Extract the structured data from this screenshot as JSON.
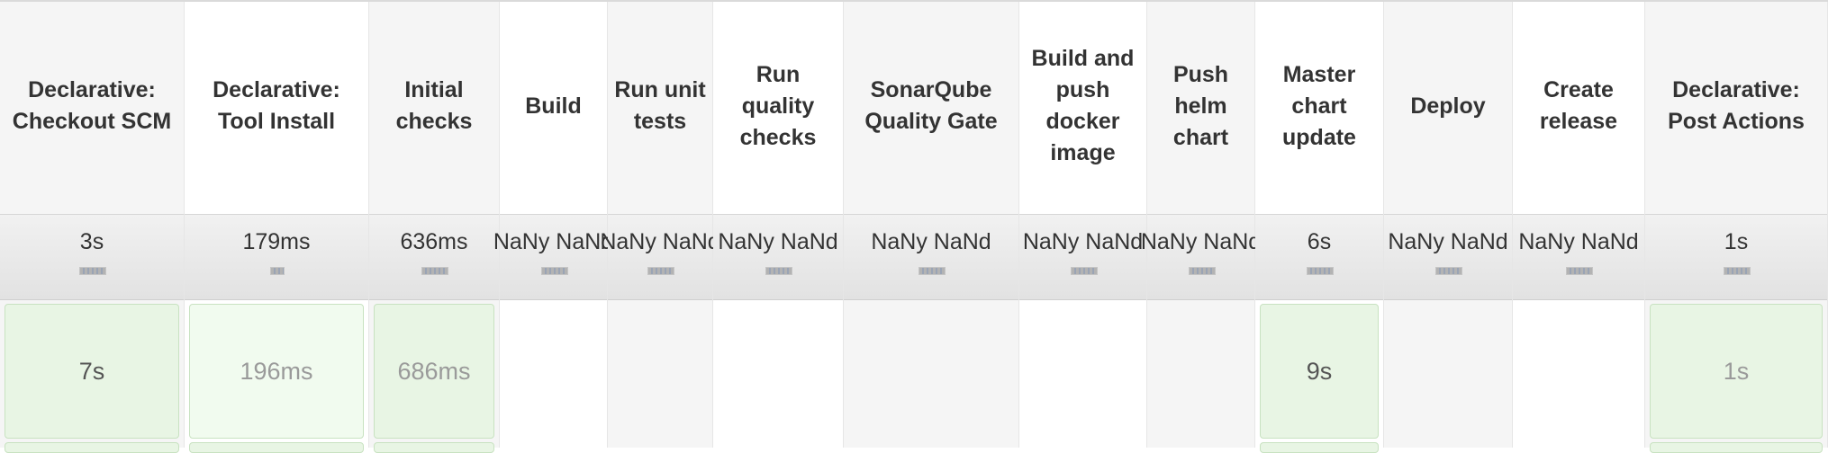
{
  "stages": [
    {
      "name": "Declarative: Checkout SCM",
      "avg": "3s",
      "run": "7s"
    },
    {
      "name": "Declarative: Tool Install",
      "avg": "179ms",
      "run": "196ms"
    },
    {
      "name": "Initial checks",
      "avg": "636ms",
      "run": "686ms"
    },
    {
      "name": "Build",
      "avg": "NaNy NaNd",
      "run": ""
    },
    {
      "name": "Run unit tests",
      "avg": "NaNy NaNd",
      "run": ""
    },
    {
      "name": "Run quality checks",
      "avg": "NaNy NaNd",
      "run": ""
    },
    {
      "name": "SonarQube Quality Gate",
      "avg": "NaNy NaNd",
      "run": ""
    },
    {
      "name": "Build and push docker image",
      "avg": "NaNy NaNd",
      "run": ""
    },
    {
      "name": "Push helm chart",
      "avg": "NaNy NaNd",
      "run": ""
    },
    {
      "name": "Master chart update",
      "avg": "6s",
      "run": "9s"
    },
    {
      "name": "Deploy",
      "avg": "NaNy NaNd",
      "run": ""
    },
    {
      "name": "Create release",
      "avg": "NaNy NaNd",
      "run": ""
    },
    {
      "name": "Declarative: Post Actions",
      "avg": "1s",
      "run": "1s"
    }
  ]
}
